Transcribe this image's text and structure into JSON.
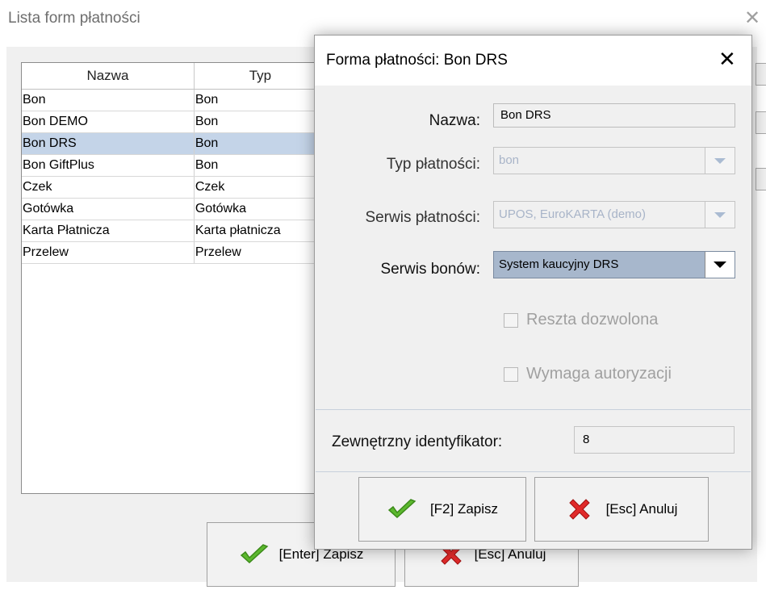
{
  "background": {
    "title": "Lista form płatności",
    "table": {
      "headers": [
        "Nazwa",
        "Typ"
      ],
      "rows": [
        {
          "name": "Bon",
          "type": "Bon"
        },
        {
          "name": "Bon DEMO",
          "type": "Bon"
        },
        {
          "name": "Bon DRS",
          "type": "Bon"
        },
        {
          "name": "Bon GiftPlus",
          "type": "Bon"
        },
        {
          "name": "Czek",
          "type": "Czek"
        },
        {
          "name": "Gotówka",
          "type": "Gotówka"
        },
        {
          "name": "Karta Płatnicza",
          "type": "Karta płatnicza"
        },
        {
          "name": "Przelew",
          "type": "Przelew"
        }
      ],
      "selected_row": "Bon DRS"
    },
    "save_label": "[Enter] Zapisz",
    "cancel_label": "[Esc] Anuluj"
  },
  "dialog": {
    "title": "Forma płatności: Bon DRS",
    "name_label": "Nazwa:",
    "name_value": "Bon DRS",
    "payment_type_label": "Typ płatności:",
    "payment_type_value": "bon",
    "payment_service_label": "Serwis płatności:",
    "payment_service_value": "UPOS, EuroKARTA (demo)",
    "voucher_service_label": "Serwis bonów:",
    "voucher_service_value": "System kaucyjny DRS",
    "change_allowed_label": "Reszta dozwolona",
    "change_allowed_checked": false,
    "requires_auth_label": "Wymaga autoryzacji",
    "requires_auth_checked": false,
    "external_id_label": "Zewnętrzny identyfikator:",
    "external_id_value": "8",
    "save_label": "[F2] Zapisz",
    "cancel_label": "[Esc] Anuluj"
  },
  "colors": {
    "selected_row": "#c4d4e8",
    "active_combo": "#a7b7cc",
    "check_green": "#5cb82e",
    "cross_red": "#e02a2a"
  }
}
